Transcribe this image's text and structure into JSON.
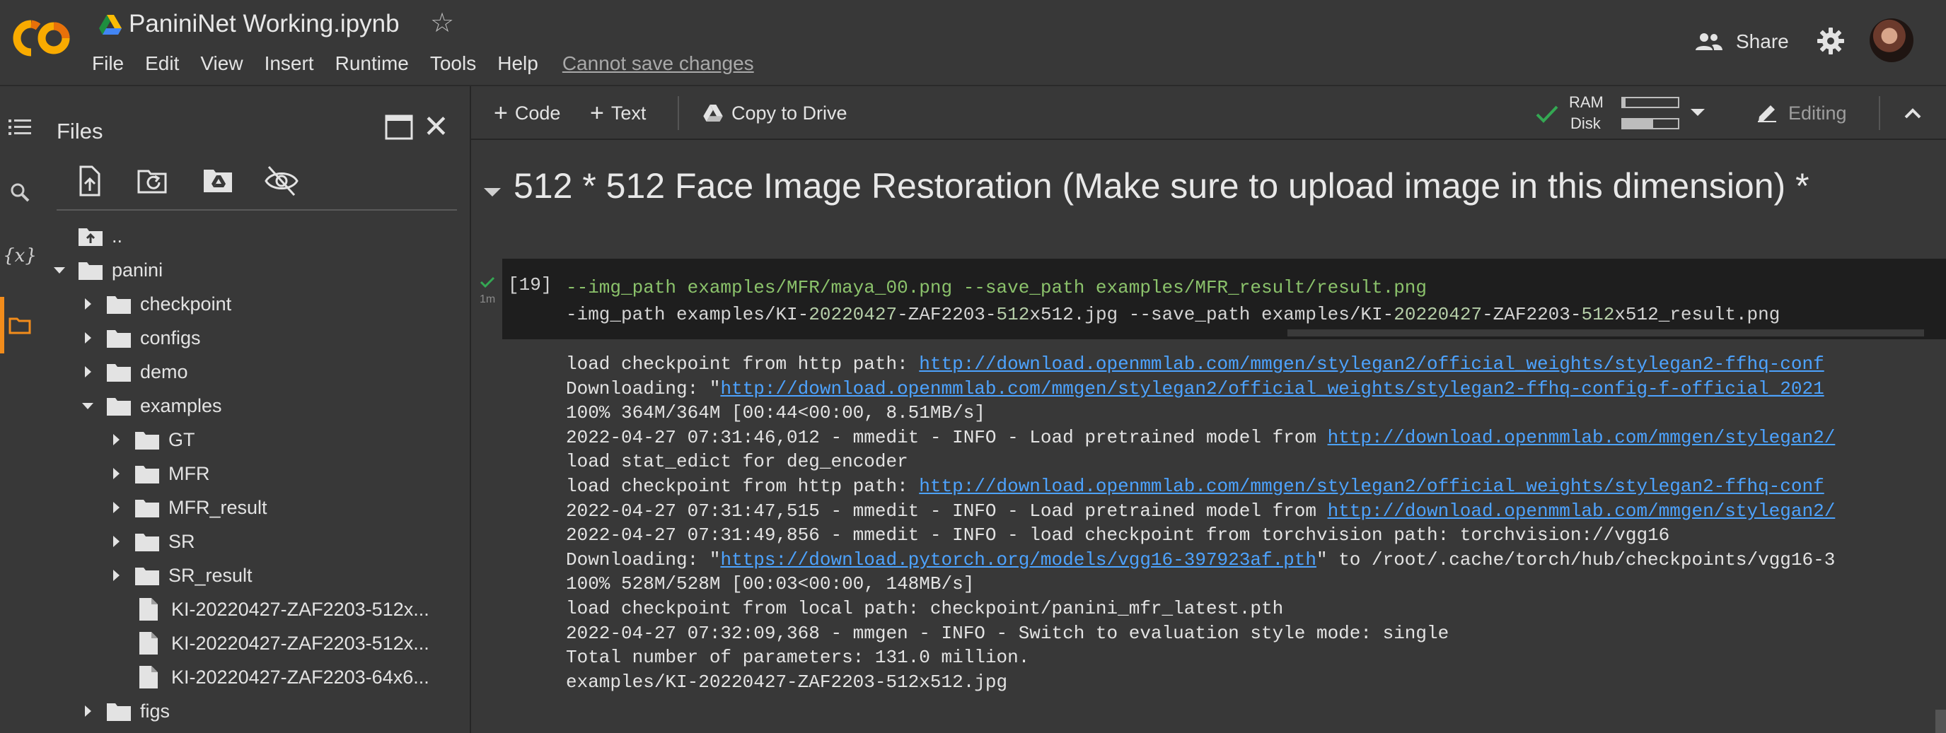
{
  "header": {
    "notebook_title": "PaniniNet Working.ipynb",
    "menu": [
      "File",
      "Edit",
      "View",
      "Insert",
      "Runtime",
      "Tools",
      "Help"
    ],
    "cannot_save": "Cannot save changes",
    "share_label": "Share"
  },
  "rail": {
    "icons": [
      "table-of-contents-icon",
      "search-icon",
      "variables-icon",
      "files-icon"
    ],
    "variables_glyph": "{x}"
  },
  "files": {
    "title": "Files",
    "tools": [
      "upload-file-icon",
      "refresh-icon",
      "mount-drive-icon",
      "hide-files-icon"
    ],
    "tree": [
      {
        "label": "..",
        "kind": "up",
        "depth": 0,
        "chev": "none"
      },
      {
        "label": "panini",
        "kind": "folder",
        "depth": 0,
        "chev": "open"
      },
      {
        "label": "checkpoint",
        "kind": "folder",
        "depth": 1,
        "chev": "closed"
      },
      {
        "label": "configs",
        "kind": "folder",
        "depth": 1,
        "chev": "closed"
      },
      {
        "label": "demo",
        "kind": "folder",
        "depth": 1,
        "chev": "closed"
      },
      {
        "label": "examples",
        "kind": "folder",
        "depth": 1,
        "chev": "open"
      },
      {
        "label": "GT",
        "kind": "folder",
        "depth": 2,
        "chev": "closed"
      },
      {
        "label": "MFR",
        "kind": "folder",
        "depth": 2,
        "chev": "closed"
      },
      {
        "label": "MFR_result",
        "kind": "folder",
        "depth": 2,
        "chev": "closed"
      },
      {
        "label": "SR",
        "kind": "folder",
        "depth": 2,
        "chev": "closed"
      },
      {
        "label": "SR_result",
        "kind": "folder",
        "depth": 2,
        "chev": "closed"
      },
      {
        "label": "KI-20220427-ZAF2203-512x...",
        "kind": "file",
        "depth": 2,
        "chev": "none"
      },
      {
        "label": "KI-20220427-ZAF2203-512x...",
        "kind": "file",
        "depth": 2,
        "chev": "none"
      },
      {
        "label": "KI-20220427-ZAF2203-64x6...",
        "kind": "file",
        "depth": 2,
        "chev": "none"
      },
      {
        "label": "figs",
        "kind": "folder",
        "depth": 1,
        "chev": "closed"
      }
    ]
  },
  "toolbar": {
    "code_label": "Code",
    "text_label": "Text",
    "copy_label": "Copy to Drive",
    "ram_label": "RAM",
    "disk_label": "Disk",
    "ram_usage": 0.05,
    "disk_usage": 0.55,
    "editing_label": "Editing"
  },
  "notebook": {
    "section_title": "512 * 512 Face Image Restoration (Make sure to upload image in this dimension) *",
    "cell": {
      "exec_count": "[19]",
      "exec_time": "1m",
      "line1": "--img_path examples/MFR/maya_00.png --save_path examples/MFR_result/result.png",
      "line2_parts": [
        "-img_path examples/KI-",
        "20220427",
        "-ZAF2203-",
        "512",
        "x512.jpg --save_path examples/KI-",
        "20220427",
        "-ZAF2203-",
        "512",
        "x512_result.png"
      ]
    },
    "output": [
      {
        "t": "load checkpoint from http path: ",
        "link": "http://download.openmmlab.com/mmgen/stylegan2/official_weights/stylegan2-ffhq-conf",
        "after": ""
      },
      {
        "t": "Downloading: \"",
        "link": "http://download.openmmlab.com/mmgen/stylegan2/official_weights/stylegan2-ffhq-config-f-official_2021",
        "after": ""
      },
      {
        "t": "100% 364M/364M [00:44<00:00, 8.51MB/s]",
        "link": "",
        "after": ""
      },
      {
        "t": "2022-04-27 07:31:46,012 - mmedit - INFO - Load pretrained model from ",
        "link": "http://download.openmmlab.com/mmgen/stylegan2/",
        "after": ""
      },
      {
        "t": "load stat_edict for deg_encoder",
        "link": "",
        "after": ""
      },
      {
        "t": "load checkpoint from http path: ",
        "link": "http://download.openmmlab.com/mmgen/stylegan2/official_weights/stylegan2-ffhq-conf",
        "after": ""
      },
      {
        "t": "2022-04-27 07:31:47,515 - mmedit - INFO - Load pretrained model from ",
        "link": "http://download.openmmlab.com/mmgen/stylegan2/",
        "after": ""
      },
      {
        "t": "2022-04-27 07:31:49,856 - mmedit - INFO - load checkpoint from torchvision path: torchvision://vgg16",
        "link": "",
        "after": ""
      },
      {
        "t": "Downloading: \"",
        "link": "https://download.pytorch.org/models/vgg16-397923af.pth",
        "after": "\" to /root/.cache/torch/hub/checkpoints/vgg16-3"
      },
      {
        "t": "100% 528M/528M [00:03<00:00, 148MB/s]",
        "link": "",
        "after": ""
      },
      {
        "t": "load checkpoint from local path: checkpoint/panini_mfr_latest.pth",
        "link": "",
        "after": ""
      },
      {
        "t": "2022-04-27 07:32:09,368 - mmgen - INFO - Switch to evaluation style mode: single",
        "link": "",
        "after": ""
      },
      {
        "t": "Total number of parameters: 131.0 million.",
        "link": "",
        "after": ""
      },
      {
        "t": "examples/KI-20220427-ZAF2203-512x512.jpg",
        "link": "",
        "after": ""
      }
    ]
  },
  "colors": {
    "background": "#383838",
    "cell_background": "#1e1e1e",
    "accent_orange": "#f28c1b",
    "link": "#4da3ff",
    "code_green": "#8bc26b",
    "check_green": "#34a853"
  }
}
